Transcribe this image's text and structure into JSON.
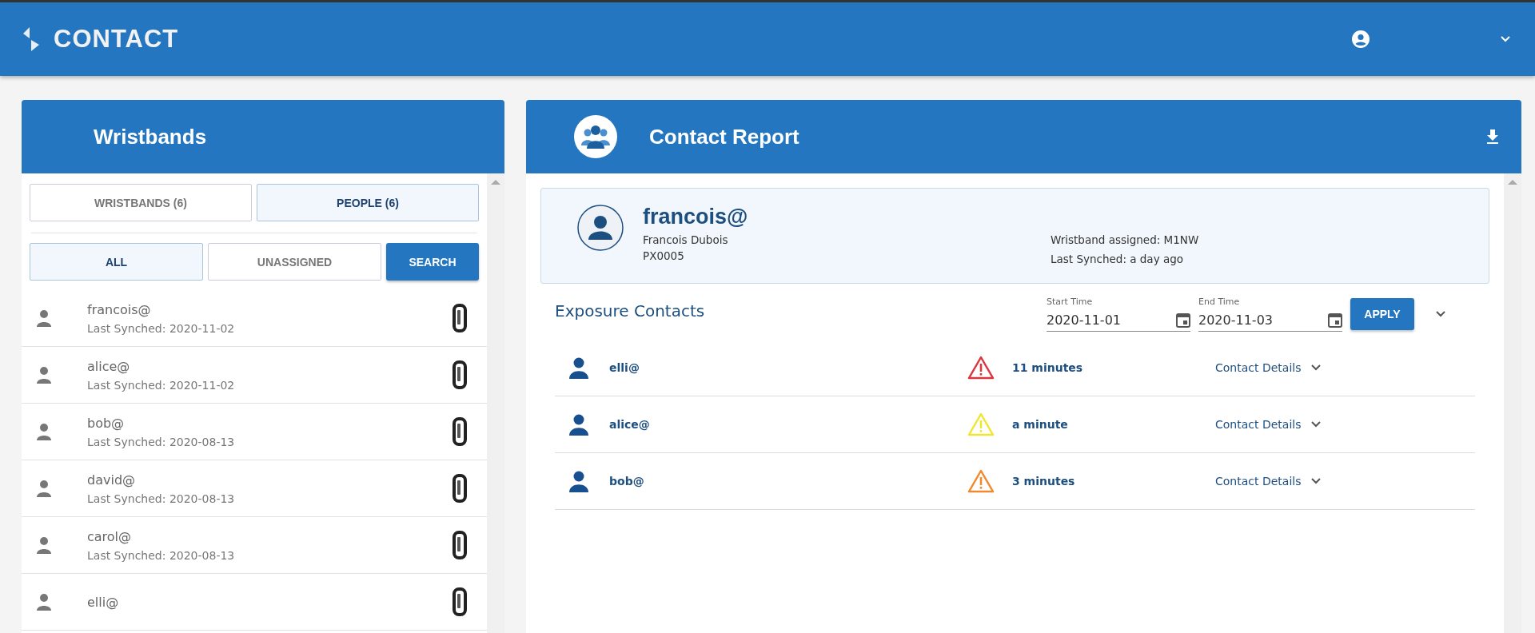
{
  "app": {
    "title": "CONTACT"
  },
  "wristbands_panel": {
    "title": "Wristbands",
    "tabs": [
      {
        "label": "WRISTBANDS (6)",
        "selected": false
      },
      {
        "label": "PEOPLE (6)",
        "selected": true
      }
    ],
    "filters": [
      {
        "label": "ALL",
        "selected": true
      },
      {
        "label": "UNASSIGNED",
        "selected": false
      }
    ],
    "search_button": "SEARCH",
    "people": [
      {
        "name": "francois@",
        "synched": "Last Synched: 2020-11-02"
      },
      {
        "name": "alice@",
        "synched": "Last Synched: 2020-11-02"
      },
      {
        "name": "bob@",
        "synched": "Last Synched: 2020-08-13"
      },
      {
        "name": "david@",
        "synched": "Last Synched: 2020-08-13"
      },
      {
        "name": "carol@",
        "synched": "Last Synched: 2020-08-13"
      },
      {
        "name": "elli@"
      }
    ]
  },
  "report_panel": {
    "title": "Contact Report",
    "person": {
      "username": "francois@",
      "full_name": "Francois Dubois",
      "id": "PX0005",
      "wristband": "Wristband assigned: M1NW",
      "synched": "Last Synched: a day ago"
    },
    "exposure_title": "Exposure Contacts",
    "start_time": {
      "label": "Start Time",
      "value": "2020-11-01"
    },
    "end_time": {
      "label": "End Time",
      "value": "2020-11-03"
    },
    "apply_button": "APPLY",
    "contacts": [
      {
        "name": "elli@",
        "duration": "11 minutes",
        "color": "#d9363e",
        "details": "Contact Details"
      },
      {
        "name": "alice@",
        "duration": "a minute",
        "color": "#f0e630",
        "details": "Contact Details"
      },
      {
        "name": "bob@",
        "duration": "3 minutes",
        "color": "#ef8a2e",
        "details": "Contact Details"
      }
    ]
  }
}
